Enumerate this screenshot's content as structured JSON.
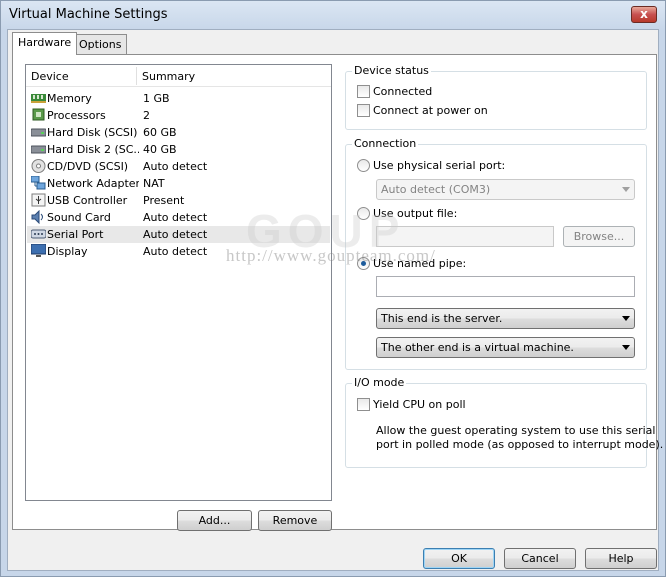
{
  "window": {
    "title": "Virtual Machine Settings",
    "close_label": "x"
  },
  "tabs": [
    {
      "label": "Hardware"
    },
    {
      "label": "Options"
    }
  ],
  "device_list": {
    "columns": {
      "device": "Device",
      "summary": "Summary"
    },
    "rows": [
      {
        "name": "Memory",
        "summary": "1 GB",
        "icon": "memory-icon"
      },
      {
        "name": "Processors",
        "summary": "2",
        "icon": "processor-icon"
      },
      {
        "name": "Hard Disk (SCSI)",
        "summary": "60 GB",
        "icon": "hard-disk-icon"
      },
      {
        "name": "Hard Disk 2 (SC...",
        "summary": "40 GB",
        "icon": "hard-disk-icon"
      },
      {
        "name": "CD/DVD (SCSI)",
        "summary": "Auto detect",
        "icon": "cd-dvd-icon"
      },
      {
        "name": "Network Adapter",
        "summary": "NAT",
        "icon": "network-icon"
      },
      {
        "name": "USB Controller",
        "summary": "Present",
        "icon": "usb-icon"
      },
      {
        "name": "Sound Card",
        "summary": "Auto detect",
        "icon": "speaker-icon"
      },
      {
        "name": "Serial Port",
        "summary": "Auto detect",
        "icon": "serial-port-icon",
        "selected": true
      },
      {
        "name": "Display",
        "summary": "Auto detect",
        "icon": "monitor-icon"
      }
    ]
  },
  "buttons": {
    "add": "Add...",
    "remove": "Remove",
    "ok": "OK",
    "cancel": "Cancel",
    "help": "Help"
  },
  "device_status": {
    "legend": "Device status",
    "connected": "Connected",
    "connect_at_power_on": "Connect at power on"
  },
  "connection": {
    "legend": "Connection",
    "physical_port_label": "Use physical serial port:",
    "physical_port_value": "Auto detect (COM3)",
    "output_file_label": "Use output file:",
    "output_file_value": "",
    "browse": "Browse...",
    "named_pipe_label": "Use named pipe:",
    "named_pipe_value": "",
    "end_select": "This end is the server.",
    "other_end_select": "The other end is a virtual machine."
  },
  "io_mode": {
    "legend": "I/O mode",
    "yield_cpu": "Yield CPU on poll",
    "description_line1": "Allow the guest operating system to use this serial",
    "description_line2": "port in polled mode (as opposed to interrupt mode)."
  },
  "watermark": {
    "logo": "GOUP",
    "url": "http://www.goupteam.com/"
  }
}
